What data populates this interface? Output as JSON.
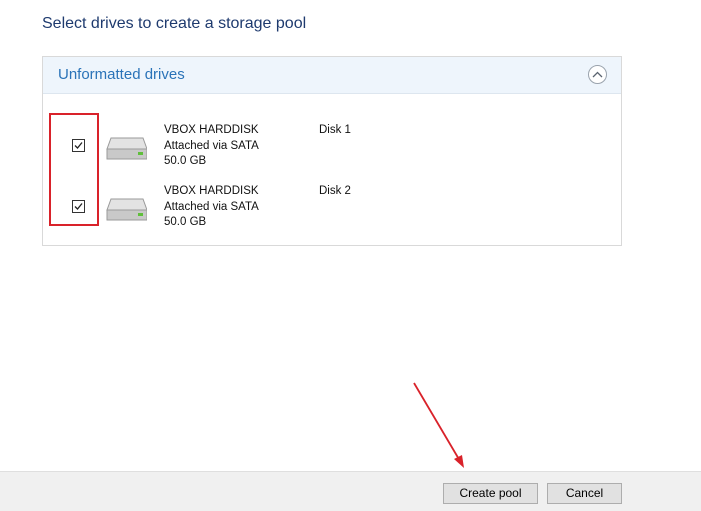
{
  "page": {
    "heading": "Select drives to create a storage pool"
  },
  "drive_group": {
    "title": "Unformatted drives",
    "collapse_icon": "chevron-up-icon",
    "drives": [
      {
        "checked": true,
        "name": "VBOX HARDDISK",
        "connection": "Attached via SATA",
        "size": "50.0 GB",
        "disk": "Disk 1",
        "icon": "hard-drive-icon"
      },
      {
        "checked": true,
        "name": "VBOX HARDDISK",
        "connection": "Attached via SATA",
        "size": "50.0 GB",
        "disk": "Disk 2",
        "icon": "hard-drive-icon"
      }
    ]
  },
  "annotations": {
    "highlight_color": "#d9222a",
    "arrow_color": "#d9222a"
  },
  "footer": {
    "create_label": "Create pool",
    "cancel_label": "Cancel"
  },
  "colors": {
    "heading": "#1e3a6e",
    "group_title": "#2a73b8",
    "group_header_bg": "#eef5fc",
    "footer_bg": "#f0f0f0"
  }
}
